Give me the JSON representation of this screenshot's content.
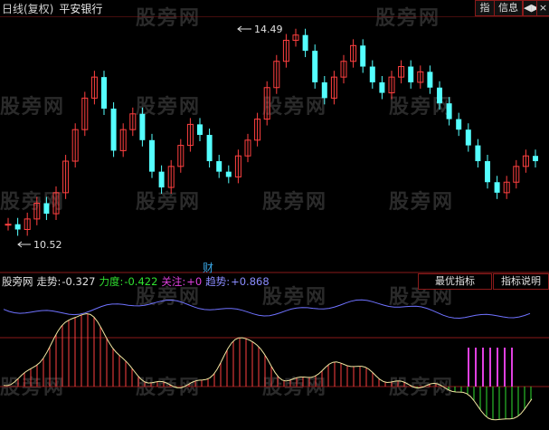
{
  "header": {
    "chart_type_label": "日线(复权)",
    "stock_name": "平安银行",
    "btn_zhi": "指",
    "btn_info": "信息",
    "btn_nav": "◀▶",
    "btn_close": "×"
  },
  "watermark": "股旁网",
  "main": {
    "high_label": "14.49",
    "low_label": "10.52",
    "finance_marker": "财"
  },
  "indicator": {
    "name": "股旁网",
    "zoushi_label": "走势:",
    "zoushi_value": "-0.327",
    "lidu_label": "力度:",
    "lidu_value": "-0.422",
    "guanzhu_label": "关注:",
    "guanzhu_value": "+0",
    "qushi_label": "趋势:",
    "qushi_value": "+0.868"
  },
  "sub_buttons": {
    "best": "最优指标",
    "desc": "指标说明"
  },
  "colors": {
    "up": "#ff4040",
    "down": "#54ffff",
    "grid": "#8a1a1a",
    "blue_line": "#6f72ff",
    "yellow_line": "#f0e6a0",
    "green_bar": "#30e030",
    "magenta_bar": "#e040e0"
  }
}
